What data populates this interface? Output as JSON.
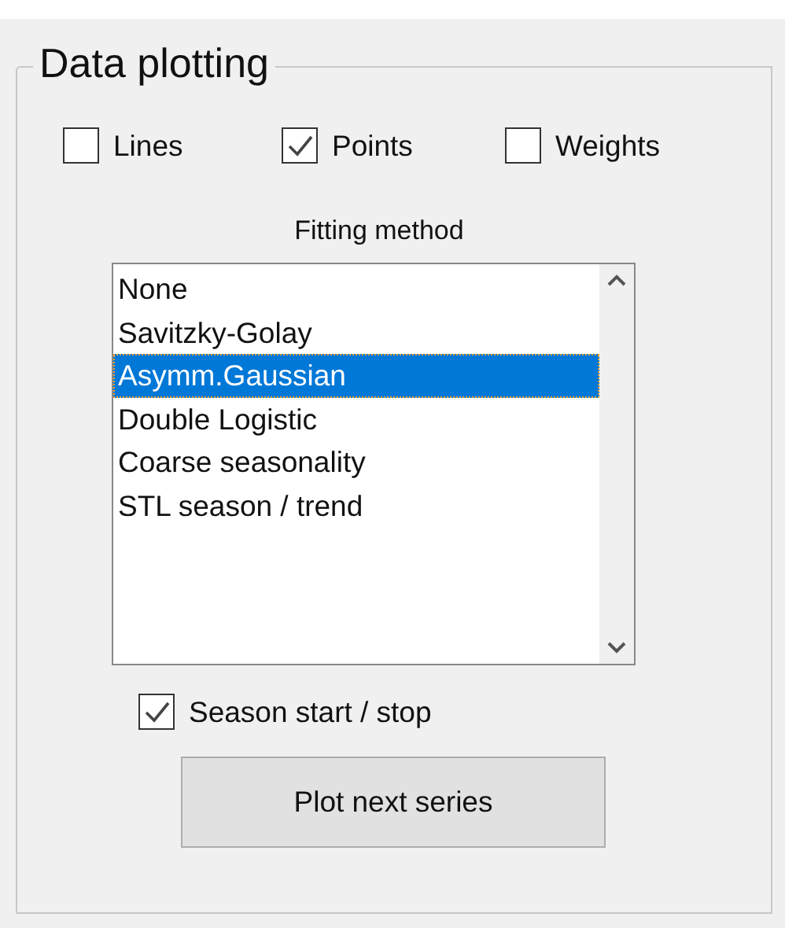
{
  "group": {
    "title": "Data plotting"
  },
  "options": [
    {
      "label": "Lines",
      "checked": false
    },
    {
      "label": "Points",
      "checked": true
    },
    {
      "label": "Weights",
      "checked": false
    }
  ],
  "fitting_method": {
    "label": "Fitting method",
    "items": [
      {
        "label": "None",
        "selected": false
      },
      {
        "label": "Savitzky-Golay",
        "selected": false
      },
      {
        "label": "Asymm.Gaussian",
        "selected": true
      },
      {
        "label": "Double Logistic",
        "selected": false
      },
      {
        "label": "Coarse seasonality",
        "selected": false
      },
      {
        "label": "STL season / trend",
        "selected": false
      }
    ]
  },
  "season": {
    "label": "Season start / stop",
    "checked": true
  },
  "button": {
    "label": "Plot next series"
  }
}
